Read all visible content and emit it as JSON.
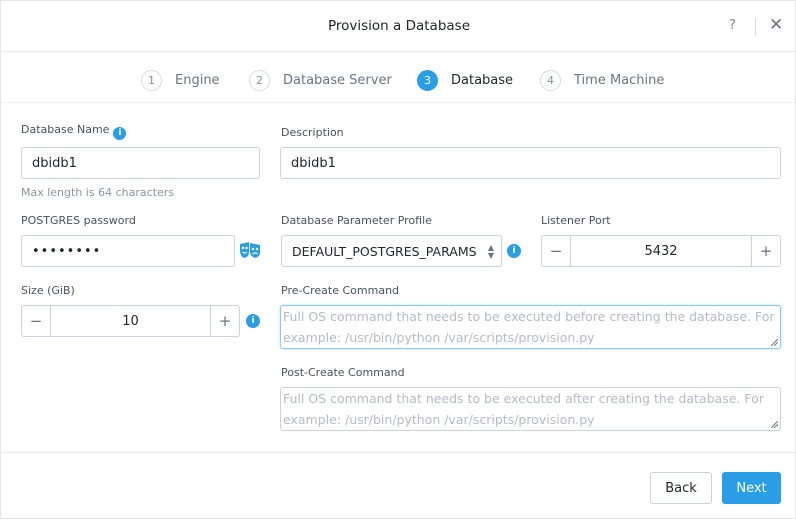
{
  "dialog": {
    "title": "Provision a Database",
    "help_label": "?",
    "close_label": "✕"
  },
  "steps": [
    {
      "number": "1",
      "label": "Engine"
    },
    {
      "number": "2",
      "label": "Database Server"
    },
    {
      "number": "3",
      "label": "Database"
    },
    {
      "number": "4",
      "label": "Time Machine"
    }
  ],
  "active_step": "Database",
  "form": {
    "db_name_label": "Database Name",
    "db_name_value": "dbidb1",
    "db_name_hint": "Max length is 64 characters",
    "description_label": "Description",
    "description_value": "dbidb1",
    "password_label": "POSTGRES password",
    "password_value": "••••••••",
    "param_profile_label": "Database Parameter Profile",
    "param_profile_value": "DEFAULT_POSTGRES_PARAMS",
    "listener_port_label": "Listener Port",
    "listener_port_value": "5432",
    "size_label": "Size (GiB)",
    "size_value": "10",
    "pre_create_label": "Pre-Create Command",
    "pre_create_placeholder": "Full OS command that needs to be executed before creating the database. For example: /usr/bin/python /var/scripts/provision.py",
    "post_create_label": "Post-Create Command",
    "post_create_placeholder": "Full OS command that needs to be executed after creating the database. For example: /usr/bin/python /var/scripts/provision.py",
    "minus": "−",
    "plus": "+",
    "info_glyph": "i"
  },
  "footer": {
    "back_label": "Back",
    "next_label": "Next"
  },
  "colors": {
    "accent": "#2a9ee6"
  }
}
